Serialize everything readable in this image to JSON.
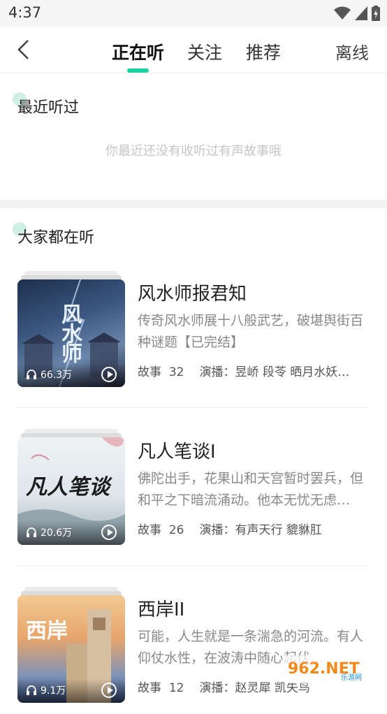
{
  "status": {
    "time": "4:37"
  },
  "header": {
    "tabs": [
      {
        "label": "正在听",
        "active": true
      },
      {
        "label": "关注",
        "active": false
      },
      {
        "label": "推荐",
        "active": false
      }
    ],
    "offline_label": "离线",
    "accent_color": "#1ccfa3"
  },
  "recent": {
    "title": "最近听过",
    "empty_text": "你最近还没有收听过有声故事哦"
  },
  "popular": {
    "title": "大家都在听",
    "books": [
      {
        "title": "风水师报君知",
        "description": "传奇风水师展十八般武艺，破堪舆街百种谜题【已完结】",
        "plays": "66.3万",
        "stories_label": "故事",
        "stories": "32",
        "narrators_label": "演播：",
        "narrators": "昱峤 段苓 晒月水妖…",
        "cover_text": "风水师"
      },
      {
        "title": "凡人笔谈I",
        "description": "佛陀出手，花果山和天宫暂时罢兵，但和平之下暗流涌动。他本无忧无虑…",
        "plays": "20.6万",
        "stories_label": "故事",
        "stories": "26",
        "narrators_label": "演播：",
        "narrators": "有声天行 貔貅肛",
        "cover_text": "凡人笔谈"
      },
      {
        "title": "西岸II",
        "description": "可能，人生就是一条湍急的河流。有人仰仗水性，在波涛中随心起伏…",
        "plays": "9.1万",
        "stories_label": "故事",
        "stories": "12",
        "narrators_label": "演播：",
        "narrators": "赵灵犀 凯失鸟",
        "cover_text": "西岸"
      }
    ]
  },
  "watermark": {
    "text": "962.NET",
    "subtext": "乐游网"
  }
}
